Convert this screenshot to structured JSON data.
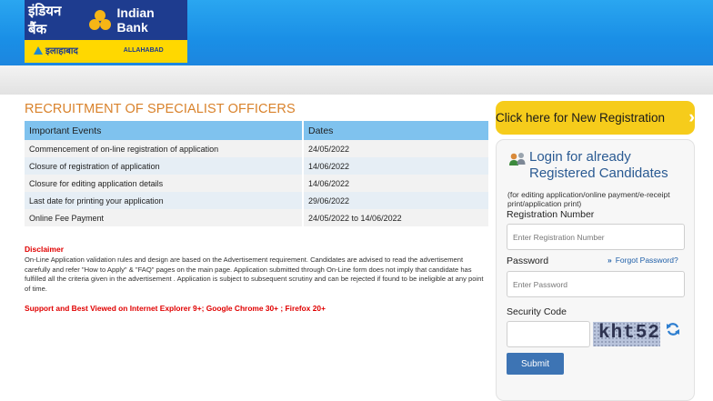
{
  "header": {
    "logo_hindi": "इंडियन बैंक",
    "logo_english": "Indian Bank",
    "logo_sub_hindi": "इलाहाबाद",
    "logo_sub_english": "ALLAHABAD"
  },
  "main": {
    "title": "RECRUITMENT OF SPECIALIST OFFICERS",
    "table_headers": [
      "Important Events",
      "Dates"
    ],
    "events": [
      {
        "event": "Commencement of on-line registration of application",
        "date": "24/05/2022"
      },
      {
        "event": "Closure of registration of application",
        "date": "14/06/2022"
      },
      {
        "event": "Closure for editing application details",
        "date": "14/06/2022"
      },
      {
        "event": "Last date for printing your application",
        "date": "29/06/2022"
      },
      {
        "event": "Online Fee Payment",
        "date": "24/05/2022 to 14/06/2022"
      }
    ],
    "disclaimer_title": "Disclaimer",
    "disclaimer_text": "On-Line Application validation rules and design are based on the Advertisement requirement. Candidates are advised to read the advertisement carefully and refer \"How to Apply\" & \"FAQ\" pages on the main page. Application submitted through On-Line form does not imply that candidate has fulfilled all the criteria given in the advertisement . Application is subject to subsequent scrutiny and can be rejected if found to be ineligible at any point of time.",
    "support_text": "Support and Best Viewed on Internet Explorer 9+; Google Chrome 30+ ; Firefox 20+"
  },
  "sidebar": {
    "new_registration_label": "Click here for New Registration",
    "login_title_line1": "Login for already",
    "login_title_line2": "Registered Candidates",
    "login_note": "(for editing application/online payment/e-receipt print/application print)",
    "registration_label": "Registration Number",
    "registration_placeholder": "Enter Registration Number",
    "password_label": "Password",
    "password_placeholder": "Enter Password",
    "forgot_password": "Forgot Password?",
    "security_label": "Security Code",
    "captcha_text": "kht52",
    "submit_label": "Submit"
  },
  "colors": {
    "header_blue": "#1a8fe6",
    "title_orange": "#d9822b",
    "table_header": "#7fc2ee",
    "disclaimer_red": "#e00000",
    "cta_yellow": "#f6cc1b",
    "submit_blue": "#3d74b4"
  }
}
